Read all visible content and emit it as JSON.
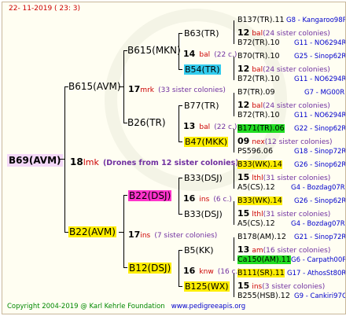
{
  "date": "22- 11-2019 ( 23: 3)",
  "root": {
    "label": "B69(AVM)",
    "num": "18",
    "tag": "lmk",
    "note": "(Drones from 12 sister colonies)"
  },
  "g1": {
    "top": {
      "label": "B615(AVM)",
      "num": "17",
      "tag": "mrk",
      "note": "(33 sister colonies)"
    },
    "bottom": {
      "label": "B22(AVM)",
      "num": "17",
      "tag": "ins",
      "note": "(7 sister colonies)"
    }
  },
  "g2": {
    "a": {
      "label": "B615(MKN)",
      "num": "14",
      "tag": "bal",
      "note": "(22 c.)"
    },
    "b": {
      "label": "B26(TR)",
      "num": "13",
      "tag": "bal",
      "note": "(22 c.)"
    },
    "c": {
      "label": "B22(DSJ)",
      "num": "16",
      "tag": "ins",
      "note": "(6 c.)"
    },
    "d": {
      "label": "B12(DSJ)",
      "num": "16",
      "tag": "knw",
      "note": "(16 c.)"
    }
  },
  "g3": {
    "a1": "B63(TR)",
    "a2": "B54(TR)",
    "b1": "B77(TR)",
    "b2": "B47(MKK)",
    "c1": "B33(DSJ)",
    "c2": "B33(DSJ)",
    "d1": "B5(KK)",
    "d2": "B125(WX)"
  },
  "g4": [
    {
      "label": "B137(TR).11",
      "ref": "G8 - Kangaroo98R"
    },
    {
      "num": "12",
      "tag": "bal",
      "note": "(24 sister colonies)"
    },
    {
      "label": "B72(TR).10",
      "ref": "G11 - NO6294R"
    },
    {
      "label": "B70(TR).10",
      "ref": "G25 - Sinop62R"
    },
    {
      "num": "12",
      "tag": "bal",
      "note": "(24 sister colonies)"
    },
    {
      "label": "B72(TR).10",
      "ref": "G11 - NO6294R"
    },
    {
      "label": "B7(TR).09",
      "ref": "G7 - MG00R"
    },
    {
      "num": "12",
      "tag": "bal",
      "note": "(24 sister colonies)"
    },
    {
      "label": "B72(TR).10",
      "ref": "G11 - NO6294R"
    },
    {
      "label": "B171(TR).06",
      "ref": "G22 - Sinop62R"
    },
    {
      "num": "09",
      "tag": "nex",
      "note": "(12 sister colonies)"
    },
    {
      "label": "PS596.06",
      "ref": "G18 - Sinop72R"
    },
    {
      "label": "B33(WK).14",
      "ref": "G26 - Sinop62R"
    },
    {
      "num": "15",
      "tag": "lthl",
      "note": "(31 sister colonies)"
    },
    {
      "label": "A5(CS).12",
      "ref": "G4 - Bozdag07R"
    },
    {
      "label": "B33(WK).14",
      "ref": "G26 - Sinop62R"
    },
    {
      "num": "15",
      "tag": "lthl",
      "note": "(31 sister colonies)"
    },
    {
      "label": "A5(CS).12",
      "ref": "G4 - Bozdag07R"
    },
    {
      "label": "B178(AM).12",
      "ref": "G21 - Sinop72R"
    },
    {
      "num": "13",
      "tag": "am",
      "note": "(16 sister colonies)"
    },
    {
      "label": "Ca150(AM).11",
      "ref": "G6 - Carpath00R"
    },
    {
      "label": "B111(SR).11",
      "ref": "G17 - AthosSt80R"
    },
    {
      "num": "15",
      "tag": "ins",
      "note": "(3 sister colonies)"
    },
    {
      "label": "B255(HSB).12",
      "ref": "G9 - Cankiri97Q"
    }
  ],
  "footer": {
    "copyright": "Copyright 2004-2019 @ Karl Kehrle Foundation",
    "url": "www.pedigreeapis.org"
  },
  "colors": {
    "cyan": "#33ccee",
    "yellow": "#ffee00",
    "magenta": "#ff33cc",
    "green": "#22dd22",
    "pink": "#f4d8f8"
  }
}
